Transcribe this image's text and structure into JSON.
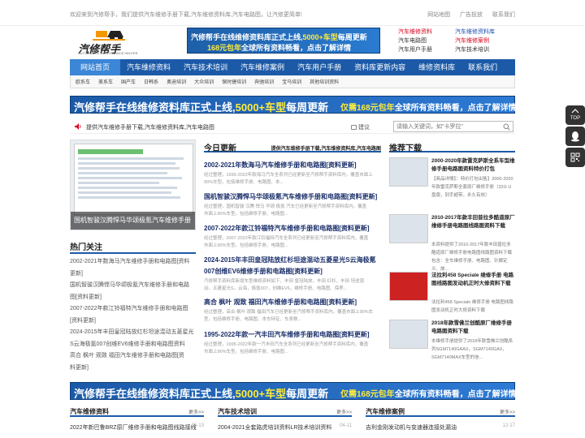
{
  "topbar": {
    "welcome": "欢迎来到汽修帮手，我们提供汽车维修手册下载,汽车维修资料库,汽车电路图，让汽修更简单!",
    "links": [
      "网站地图",
      "广告投放",
      "联系我们"
    ]
  },
  "logo": {
    "text": "汽修帮手",
    "sub": "AUTOMOBILE MAINTENANCE HELPER"
  },
  "header_banner": {
    "line1_pre": "汽修帮手在线维修资料库正式上线,",
    "line1_hl": "5000+车型",
    "line1_post": "每周更新",
    "line2_hl": "168元包年",
    "line2_post": "全球所有资料畅看，点击了解详情"
  },
  "quick_links": {
    "col1": [
      "汽车维修资料",
      "汽车电路图",
      "汽车用户手册"
    ],
    "col2": [
      "汽车维修资料库",
      "汽车维修案例",
      "汽车技术培训"
    ]
  },
  "nav": {
    "items": [
      "网站首页",
      "汽车维修资料",
      "汽车技术培训",
      "汽车维修案例",
      "汽车用户手册",
      "资料库更新内容",
      "维修资料库",
      "联系我们"
    ]
  },
  "subnav": {
    "items": [
      "欧系车",
      "美系车",
      "国产车",
      "日韩系",
      "奥迪培训",
      "大众培训",
      "保时捷培训",
      "奔驰培训",
      "宝马培训",
      "其他培训资料"
    ]
  },
  "wide_banner": {
    "t1_pre": "汽修帮手在线维修资料库正式上线,",
    "t1_hl": "5000+车型",
    "t1_post": "每周更新",
    "t2_hl": "仅需168元包年",
    "t2_post": "全球所有资料畅看，点击了解详情"
  },
  "notice": {
    "message": "提供汽车维修手册下载,汽车维修资料库,汽车电路图",
    "suggest": "建议"
  },
  "search": {
    "placeholder": "请输入关键词，如\"卡罗拉\""
  },
  "slider": {
    "caption": "国机智骏汉腾悍马华颂极氪汽车维修手册"
  },
  "hot": {
    "title": "热门关注",
    "items": [
      "2002-2021年数海马汽车维修手册和电路图[资料",
      "更新]",
      "国机智骏汉腾悍马华颂极氪汽车维修手册和电路",
      "图[资料更新]",
      "2007-2022年款江铃福特汽车维修手册和电路图",
      "[资料更新]",
      "2024-2015年丰田皇冠陆放红杉坦途混动五菱星光",
      "S云海极氪007创维EV6维修手册和电路图资料",
      "高合 枫叶 观致 福田汽车维修手册和电路图[资",
      "料更新]"
    ]
  },
  "today": {
    "title": "今日更新",
    "tagline": "提供汽车维修手册下载,汽车维修资料库,汽车电路图",
    "articles": [
      {
        "title": "2002-2021年数海马汽车维修手册和电路图[资料更新]",
        "desc1": "经过整理，1999-2022年款海马汽车全系列已经更新至汽修帮手资料库内，覆盖市面上",
        "desc2": "90%车型。包括维修手册、电路图、本..."
      },
      {
        "title": "国机智骏汉腾悍马华颂极氪汽车维修手册和电路图[资料更新]",
        "desc1": "经过整理，国机智骏 汉腾 悍马 华颂 极氪 汽车已经更新至汽修帮手资料库内。覆盖",
        "desc2": "市面上90%车型。包括维修手册、电路图..."
      },
      {
        "title": "2007-2022年款江铃福特汽车维修手册和电路图[资料更新]",
        "desc1": "经过整理，2007-2022年款江铃福特汽车全系列已经更新至汽修帮手资料库内，覆盖",
        "desc2": "市面上90%车型。包括维修手册、电路图..."
      },
      {
        "title": "2024-2015年丰田皇冠陆放红杉坦途混动五菱星光S云海极氪",
        "title2": "007创维EV6维修手册和电路图[资料更新]",
        "desc1": "汽修帮手资料库新增车型维修资料如下，丰田 皇冠陆放，丰田 红杉，丰田 坦途混",
        "desc2": "动，五菱星光S，云海，极氪007，创维EV6，维修手册、电路图、保养..."
      },
      {
        "title": "高合 枫叶 观致 福田汽车维修手册和电路图[资料更新]",
        "desc1": "经过整理，高合 枫叶 观致 福田汽车已经更新至汽修帮手资料库内。覆盖市面上90%车",
        "desc2": "型。包括维修手册、电路图、本车特征、车身数..."
      },
      {
        "title": "1995-2022年款一汽丰田汽车维修手册和电路图[资料更新]",
        "desc1": "经过整理，1995-2022年款一汽丰田汽车全系列已经更新至汽修帮手资料库内，覆盖",
        "desc2": "市面上90%车型。包括维修手册、电路图..."
      }
    ]
  },
  "recommend": {
    "title": "推荐下载",
    "items": [
      {
        "title": "2000-2020年款雷克萨斯全系车型维修手册电路图资料特价打包",
        "desc": "【商品详情】：特价打包出售】2000-2020年款雷克萨斯全套原厂维修手册（32G U盘版，别手超带，永久有效）"
      },
      {
        "title": "2010-2017年款丰田普拉多酷道原厂维修手册电路图线路图资料下载",
        "desc": "本资料提供了2010-2017年款丰田普拉多酷道原厂维修手册电路图线路图资料下载包含：全车维修手册、电路图、针脚定义、故..."
      },
      {
        "title": "法拉利458 Speciale 维修手册 电路图线路图发动机正时大修资料下载",
        "desc": "法拉利458 Speciale 维修手册 电路图线路图发动机正时大修资料下载"
      },
      {
        "title": "2018年款雪佛兰创酷原厂维修手册电路图资料下载",
        "desc": "本维修手册提供了2018年款雪佛兰创酷系列SGM7140GAAX，SGM7140GAX，SGM7140MAX车型的信..."
      }
    ]
  },
  "bottom": [
    {
      "title": "汽车维修资料",
      "more": "更多>>",
      "item": "2022年新巴鲁BRZ原厂维修手册和电路图线路接线",
      "date": "05-13"
    },
    {
      "title": "汽车技术培训",
      "more": "更多>>",
      "item": "2004-2021全套路虎培训资料LR技术培训资料",
      "date": "04-11"
    },
    {
      "title": "汽车维修案例",
      "more": "更多>>",
      "item": "吉利金刚发动机与变速器连接处漏油",
      "date": "12-17"
    }
  ],
  "side": {
    "top": "TOP"
  },
  "colors": {
    "brand_blue": "#1c5aa8",
    "accent_yellow": "#ffeb3b",
    "link_red": "#d9001b"
  }
}
